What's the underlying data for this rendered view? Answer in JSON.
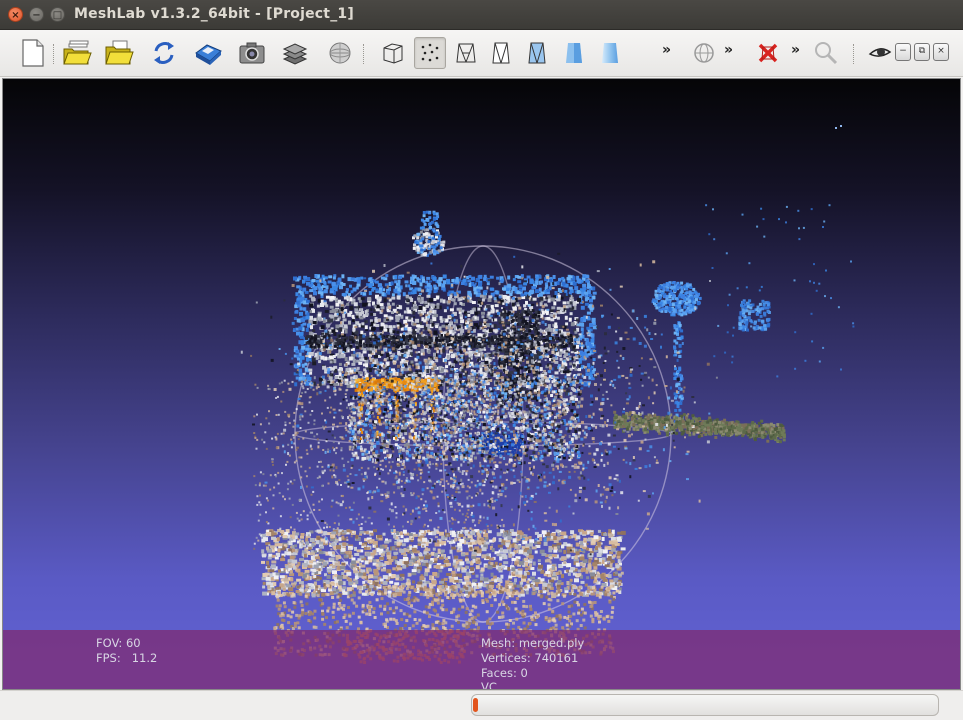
{
  "window": {
    "title": "MeshLab v1.3.2_64bit - [Project_1]",
    "controls": [
      "close-icon",
      "minimize-icon",
      "maximize-icon"
    ]
  },
  "toolbar": {
    "buttons": [
      {
        "name": "new-project",
        "icon": "new-document-icon"
      },
      {
        "name": "open-project",
        "icon": "open-folder-stack-icon"
      },
      {
        "name": "import-mesh",
        "icon": "open-folder-icon"
      },
      {
        "name": "reload",
        "icon": "reload-icon"
      },
      {
        "name": "export-mesh",
        "icon": "save-disk-icon"
      },
      {
        "name": "snapshot",
        "icon": "camera-icon"
      },
      {
        "name": "layers",
        "icon": "layers-icon"
      },
      {
        "name": "raster",
        "icon": "raster-globe-icon"
      },
      {
        "name": "bounding-box",
        "icon": "box-icon"
      },
      {
        "name": "points",
        "icon": "points-icon",
        "pressed": true
      },
      {
        "name": "wireframe",
        "icon": "wireframe-icon"
      },
      {
        "name": "hidden-lines",
        "icon": "hidden-lines-icon"
      },
      {
        "name": "flat-lines",
        "icon": "flat-lines-icon"
      },
      {
        "name": "flat",
        "icon": "flat-shade-icon"
      },
      {
        "name": "smooth",
        "icon": "smooth-shade-icon"
      }
    ],
    "overflow_glyph": "»",
    "mdi_controls": [
      "−",
      "⧉",
      "×"
    ]
  },
  "viewport": {
    "fov_label": "FOV:",
    "fov_value": "60",
    "fps_label": "FPS:",
    "fps_value": "11.2",
    "mesh_label": "Mesh:",
    "mesh_value": "merged.ply",
    "vertices_label": "Vertices:",
    "vertices_value": "740161",
    "faces_label": "Faces:",
    "faces_value": "0",
    "extra_label": "VC",
    "info_bar_color": "#80286e"
  },
  "status": {
    "progress_value": 0.01,
    "progress_color": "#e2541c"
  }
}
